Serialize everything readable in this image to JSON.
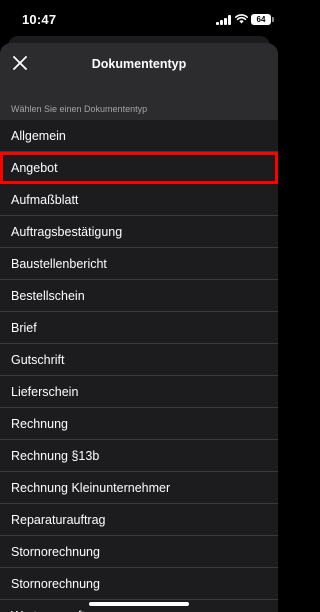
{
  "status_bar": {
    "time": "10:47",
    "battery_level": "64",
    "icons": [
      "signal-icon",
      "wifi-icon",
      "battery-icon"
    ]
  },
  "sheet": {
    "title": "Dokumententyp",
    "close_icon": "close-icon",
    "section_label": "Wählen Sie einen Dokumententyp"
  },
  "document_types": [
    "Allgemein",
    "Angebot",
    "Aufmaßblatt",
    "Auftragsbestätigung",
    "Baustellenbericht",
    "Bestellschein",
    "Brief",
    "Gutschrift",
    "Lieferschein",
    "Rechnung",
    "Rechnung §13b",
    "Rechnung Kleinunternehmer",
    "Reparaturauftrag",
    "Stornorechnung",
    "Stornorechnung",
    "Wartungsauftrag"
  ],
  "highlighted_item": "Angebot",
  "colors": {
    "highlight": "#ff0000",
    "sheet_background": "#2c2c2e",
    "list_background": "#1c1c1e",
    "secondary_text": "#a4a4a8"
  }
}
